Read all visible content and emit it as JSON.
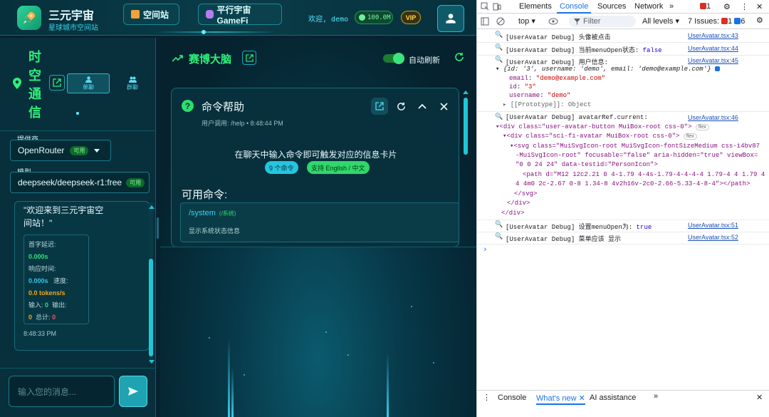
{
  "header": {
    "app_title": "三元宇宙",
    "app_subtitle": "星球城市空间站",
    "nav_station": "空间站",
    "nav_gamefi": "平行宇宙GameFi",
    "welcome": "欢迎, demo",
    "balance": "100.0M",
    "vip": "VIP"
  },
  "left": {
    "title_chars": [
      "时",
      "空",
      "通",
      "信"
    ],
    "seg_single": "单聊",
    "seg_group": "群聊",
    "provider_label": "提供商",
    "provider_value": "OpenRouter",
    "provider_badge": "可用",
    "model_label": "模型",
    "model_value": "deepseek/deepseek-r1:free",
    "model_badge": "可用",
    "message": "\"欢迎来到三元宇宙空间站！\"",
    "stats": {
      "first_latency_label": "首字延迟:",
      "first_latency_value": "0.000s",
      "response_label": "响应时间:",
      "response_value": "0.000s",
      "speed_label": "速度:",
      "speed_value": "0.0 tokens/s",
      "input_label": "输入:",
      "input_value": "0",
      "output_label": "输出:",
      "output_value": "0",
      "total_label": "总计:",
      "total_value": "0"
    },
    "timestamp": "8:48:33 PM",
    "input_placeholder": "输入您的消息..."
  },
  "right": {
    "title": "赛博大脑",
    "auto_refresh": "自动刷新",
    "card": {
      "title": "命令帮助",
      "subtitle": "用户调用: /help • 8:48:44 PM",
      "hint": "在聊天中输入命令即可触发对应的信息卡片",
      "chip_count": "9 个命令",
      "chip_lang": "支持 English / 中文",
      "available": "可用命令:",
      "cmd_name": "/system",
      "cmd_tag": "(/系统)",
      "cmd_desc": "显示系统状态信息"
    }
  },
  "devtools": {
    "tabs": [
      "Elements",
      "Console",
      "Sources",
      "Network"
    ],
    "active_tab": "Console",
    "err_count": "1",
    "context": "top",
    "filter_placeholder": "Filter",
    "levels": "All levels",
    "issues_label": "7 Issues:",
    "issues_err": "1",
    "issues_info": "6",
    "logs": [
      {
        "msg": "[UserAvatar Debug] 头像被点击",
        "src": "UserAvatar.tsx:43"
      },
      {
        "msg": "[UserAvatar Debug] 当前menuOpen状态: ",
        "val": "false",
        "src": "UserAvatar.tsx:44"
      },
      {
        "msg": "[UserAvatar Debug] 用户信息:",
        "src": "UserAvatar.tsx:45"
      },
      {
        "msg": "[UserAvatar Debug] avatarRef.current:",
        "src": "UserAvatar.tsx:46"
      },
      {
        "msg": "[UserAvatar Debug] 设置menuOpen为: ",
        "val": "true",
        "src": "UserAvatar.tsx:51"
      },
      {
        "msg": "[UserAvatar Debug] 菜单应该 显示",
        "src": "UserAvatar.tsx:52"
      }
    ],
    "obj_preview": "{id: '3', username: 'demo', email: 'demo@example.com'}",
    "obj_email": "\"demo@example.com\"",
    "obj_id": "\"3\"",
    "obj_username": "\"demo\"",
    "obj_proto": "[[Prototype]]: Object",
    "dom": {
      "l1": "<div class=\"user-avatar-button MuiBox-root css-0\">",
      "l2": "<div class=\"sci-fi-avatar MuiBox-root css-0\">",
      "l3a": "<svg class=\"MuiSvgIcon-root MuiSvgIcon-fontSizeMedium css-i4bv87",
      "l3b": "-MuiSvgIcon-root\" focusable=\"false\" aria-hidden=\"true\" viewBox=",
      "l3c": "\"0 0 24 24\" data-testid=\"PersonIcon\">",
      "l4a": "<path d=\"M12 12c2.21 0 4-1.79 4-4s-1.79-4-4-4-4 1.79-4 4 1.79 4",
      "l4b": "4 4m0 2c-2.67 0-8 1.34-8 4v2h16v-2c0-2.66-5.33-4-8-4\"></path>",
      "l5": "</svg>",
      "l6": "</div>",
      "l7": "</div>",
      "flex": "flex"
    },
    "bottom_tabs": [
      "Console",
      "What's new",
      "AI assistance"
    ]
  }
}
